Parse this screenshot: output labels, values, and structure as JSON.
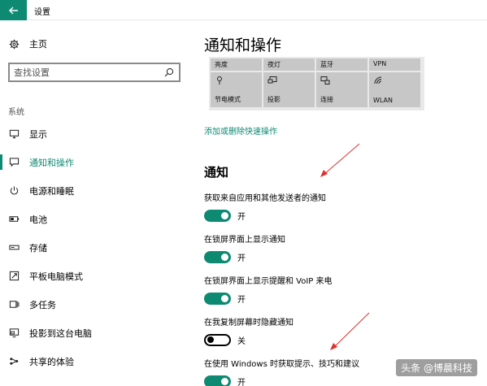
{
  "window": {
    "title": "设置"
  },
  "sidebar": {
    "home_label": "主页",
    "search_placeholder": "查找设置",
    "section_label": "系统",
    "items": [
      {
        "label": "显示",
        "icon": "monitor-icon",
        "active": false
      },
      {
        "label": "通知和操作",
        "icon": "chat-bubble-icon",
        "active": true
      },
      {
        "label": "电源和睡眠",
        "icon": "power-icon",
        "active": false
      },
      {
        "label": "电池",
        "icon": "battery-icon",
        "active": false
      },
      {
        "label": "存储",
        "icon": "storage-icon",
        "active": false
      },
      {
        "label": "平板电脑模式",
        "icon": "tablet-mode-icon",
        "active": false
      },
      {
        "label": "多任务",
        "icon": "multitask-icon",
        "active": false
      },
      {
        "label": "投影到这台电脑",
        "icon": "project-to-pc-icon",
        "active": false
      },
      {
        "label": "共享的体验",
        "icon": "shared-experience-icon",
        "active": false
      }
    ]
  },
  "main": {
    "title": "通知和操作",
    "quick_actions": {
      "top": [
        "亮度",
        "夜灯",
        "蓝牙",
        "VPN"
      ],
      "bottom": [
        {
          "label": "节电模式",
          "icon": "battery-saver-icon"
        },
        {
          "label": "投影",
          "icon": "project-icon"
        },
        {
          "label": "连接",
          "icon": "connect-icon"
        },
        {
          "label": "WLAN",
          "icon": "wifi-icon"
        }
      ]
    },
    "edit_link": "添加或删除快速操作",
    "notifications_title": "通知",
    "settings": [
      {
        "label": "获取来自应用和其他发送者的通知",
        "state": "开",
        "on": true
      },
      {
        "label": "在锁屏界面上显示通知",
        "state": "开",
        "on": true
      },
      {
        "label": "在锁屏界面上显示提醒和 VoIP 来电",
        "state": "开",
        "on": true
      },
      {
        "label": "在我复制屏幕时隐藏通知",
        "state": "关",
        "on": false
      },
      {
        "label": "在使用 Windows 时获取提示、技巧和建议",
        "state": "开",
        "on": true
      }
    ]
  },
  "watermark": "头条 @博晨科技",
  "colors": {
    "accent": "#0e8a72",
    "annotation_arrow": "#e0302a"
  }
}
